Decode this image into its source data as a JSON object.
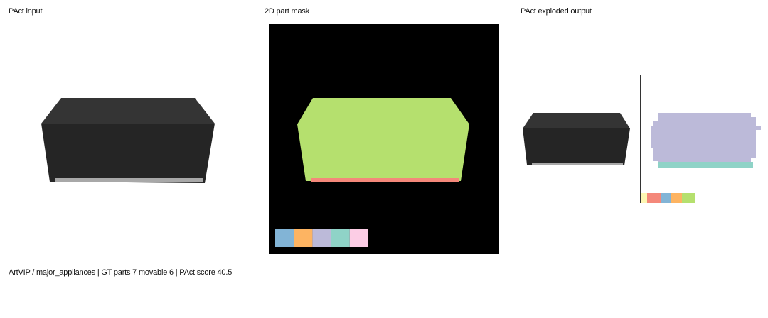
{
  "panels": {
    "input": {
      "title": "PAct input"
    },
    "mask": {
      "title": "2D part mask",
      "body_color": "#b5e06e",
      "strip_color": "#f4887a",
      "legend_swatches": [
        "#82b4d6",
        "#fdb462",
        "#bcbad9",
        "#8fd3c7",
        "#fccde5"
      ]
    },
    "exploded": {
      "title": "PAct exploded output",
      "ghost_color": "#bcbad9",
      "ghost_base_color": "#8fd3c7",
      "legend_swatches": [
        "#fdf7b3",
        "#f4887a",
        "#82b4d6",
        "#fdb462",
        "#b5e06e"
      ]
    }
  },
  "footer": {
    "caption": "ArtVIP / major_appliances | GT parts 7 movable 6 | PAct score 40.5"
  }
}
